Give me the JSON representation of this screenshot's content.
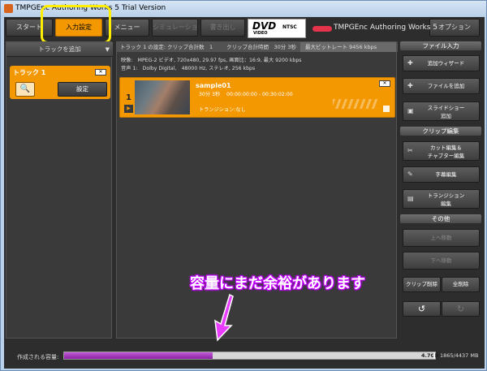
{
  "window": {
    "title": "TMPGEnc Authoring Works 5 Trial Version"
  },
  "nav": {
    "start": "スタート",
    "input_settings": "入力設定",
    "menu": "メニュー",
    "simulation": "シミュレーション",
    "output": "書き出し",
    "dvd": "DVD",
    "dvd_sub": "VIDEO",
    "ntsc": "NTSC",
    "brand": "TMPGEnc Authoring Works 5",
    "options": "オプション"
  },
  "left": {
    "add_track": "トラックを追加",
    "track_name": "トラック 1",
    "close": "✕",
    "settings": "設定"
  },
  "center": {
    "track_settings": "トラック 1 の設定: クリップ合計数　1",
    "total_time": "クリップ合計時間　30分 3秒",
    "max_bitrate": "最大ビットレート 9456 kbps",
    "video_info": "映像:　MPEG-2 ビデオ, 720x480, 29.97 fps, 画面比：16:9, 最大 9200 kbps",
    "audio_info": "音声 1:　Dolby Digital,　48000 Hz, ステレオ, 256 kbps",
    "clip": {
      "number": "1",
      "title": "sample01",
      "duration": "30分 3秒",
      "range": "00:00:00:00 - 00:30:02:00",
      "transition": "トランジション:なし"
    },
    "callout": "容量にまだ余裕があります"
  },
  "right": {
    "file_input": "ファイル入力",
    "add_wizard": "追加ウィザード",
    "add_file": "ファイルを追加",
    "slideshow_l1": "スライドショー",
    "slideshow_l2": "追加",
    "clip_edit": "クリップ編集",
    "cut_l1": "カット編集＆",
    "cut_l2": "チャプター編集",
    "subtitle": "字幕編集",
    "transition_l1": "トランジション",
    "transition_l2": "編集",
    "other": "その他",
    "move_up": "上へ移動",
    "move_down": "下へ移動",
    "delete_clip": "クリップ削除",
    "delete_all": "全削除"
  },
  "bottom": {
    "capacity_label": "作成される容量:",
    "capacity_value": "4.7GB",
    "capacity_used_fraction": 0.4,
    "capacity_total": "1865/4437 MB"
  },
  "colors": {
    "accent": "#f39800",
    "highlight": "#ffee00",
    "callout": "#c300ff"
  }
}
